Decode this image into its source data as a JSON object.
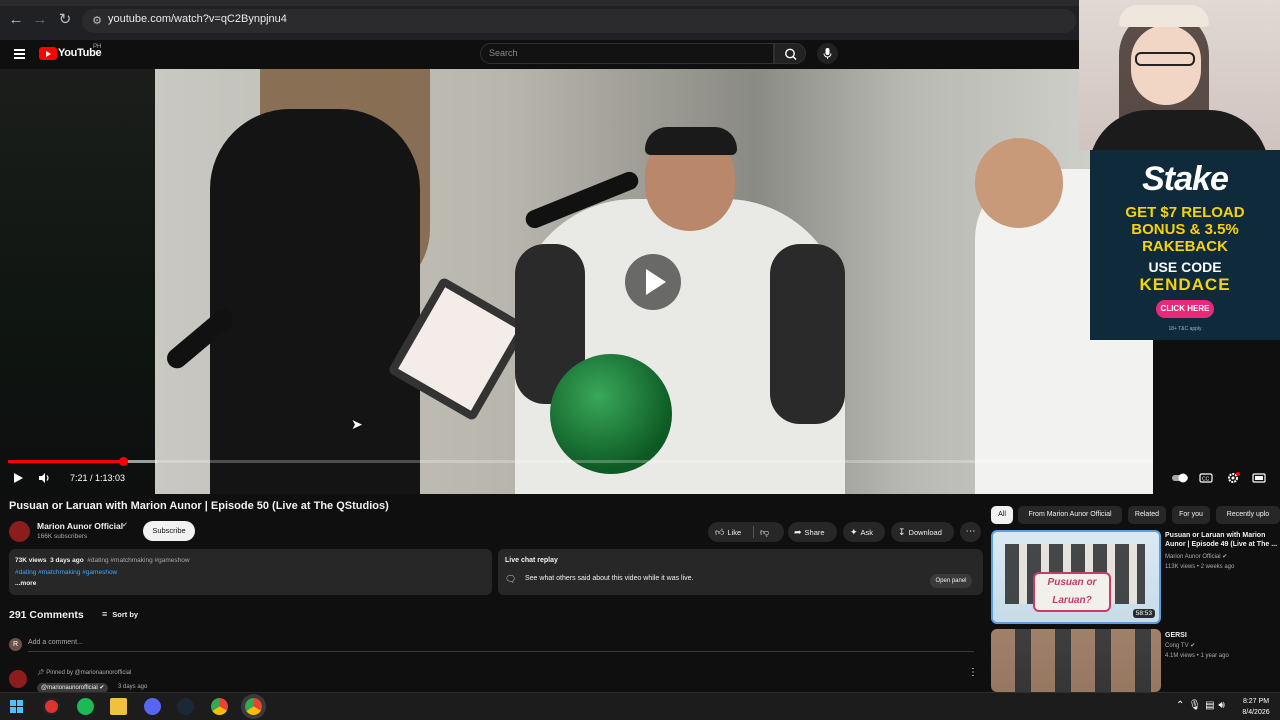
{
  "browser": {
    "url": "youtube.com/watch?v=qC2Bynpjnu4"
  },
  "header": {
    "brand": "YouTube",
    "region": "PH",
    "search_placeholder": "Search"
  },
  "player": {
    "time_display": "7:21 / 1:13:03",
    "played_fraction": 0.1,
    "buffered_fraction": 0.13
  },
  "ad": {
    "brand": "Stake",
    "line1": "GET $7 RELOAD",
    "line2": "BONUS & 3.5%",
    "line3": "RAKEBACK",
    "line4": "USE CODE",
    "code": "KENDACE",
    "cta": "CLICK HERE",
    "fine_print": "18+ T&C apply"
  },
  "video": {
    "title": "Pusuan or Laruan with Marion Aunor | Episode 50 (Live at The QStudios)",
    "channel": "Marion Aunor Official",
    "subscribers": "166K subscribers",
    "subscribe_label": "Subscribe",
    "actions": {
      "like": "Like",
      "share": "Share",
      "ask": "Ask",
      "download": "Download"
    }
  },
  "description": {
    "views": "73K views",
    "age": "3 days ago",
    "tags_line1": "#dating #matchmaking #gameshow",
    "tags_line2": "#dating #matchmaking #gameshow",
    "more": "...more"
  },
  "live_chat": {
    "heading": "Live chat replay",
    "text": "See what others said about this video while it was live.",
    "button": "Open panel"
  },
  "comments": {
    "count": "291 Comments",
    "sort_label": "Sort by",
    "avatar_letter": "R",
    "add_placeholder": "Add a comment...",
    "pinned_label": "Pinned by @marionaunorofficial",
    "first_author": "@marionaunorofficial",
    "first_time": "3 days ago"
  },
  "chips": [
    "All",
    "From Marion Aunor Official",
    "Related",
    "For you",
    "Recently uplo"
  ],
  "recommendations": [
    {
      "title": "Pusuan or Laruan with Marion Aunor | Episode 49 (Live at The ...",
      "channel": "Marion Aunor Official",
      "meta": "113K views • 2 weeks ago",
      "duration": "58:53",
      "thumb_text": "Pusuan or Laruan?"
    },
    {
      "title": "GERSI",
      "channel": "Cong TV",
      "meta": "4.1M views • 1 year ago"
    }
  ],
  "taskbar": {
    "time": "8:27 PM",
    "date": "8/4/2026"
  },
  "colors": {
    "accent": "#ff0000",
    "link": "#3ea6ff",
    "ad_yellow": "#f5d30b",
    "ad_pink": "#e8297a"
  }
}
